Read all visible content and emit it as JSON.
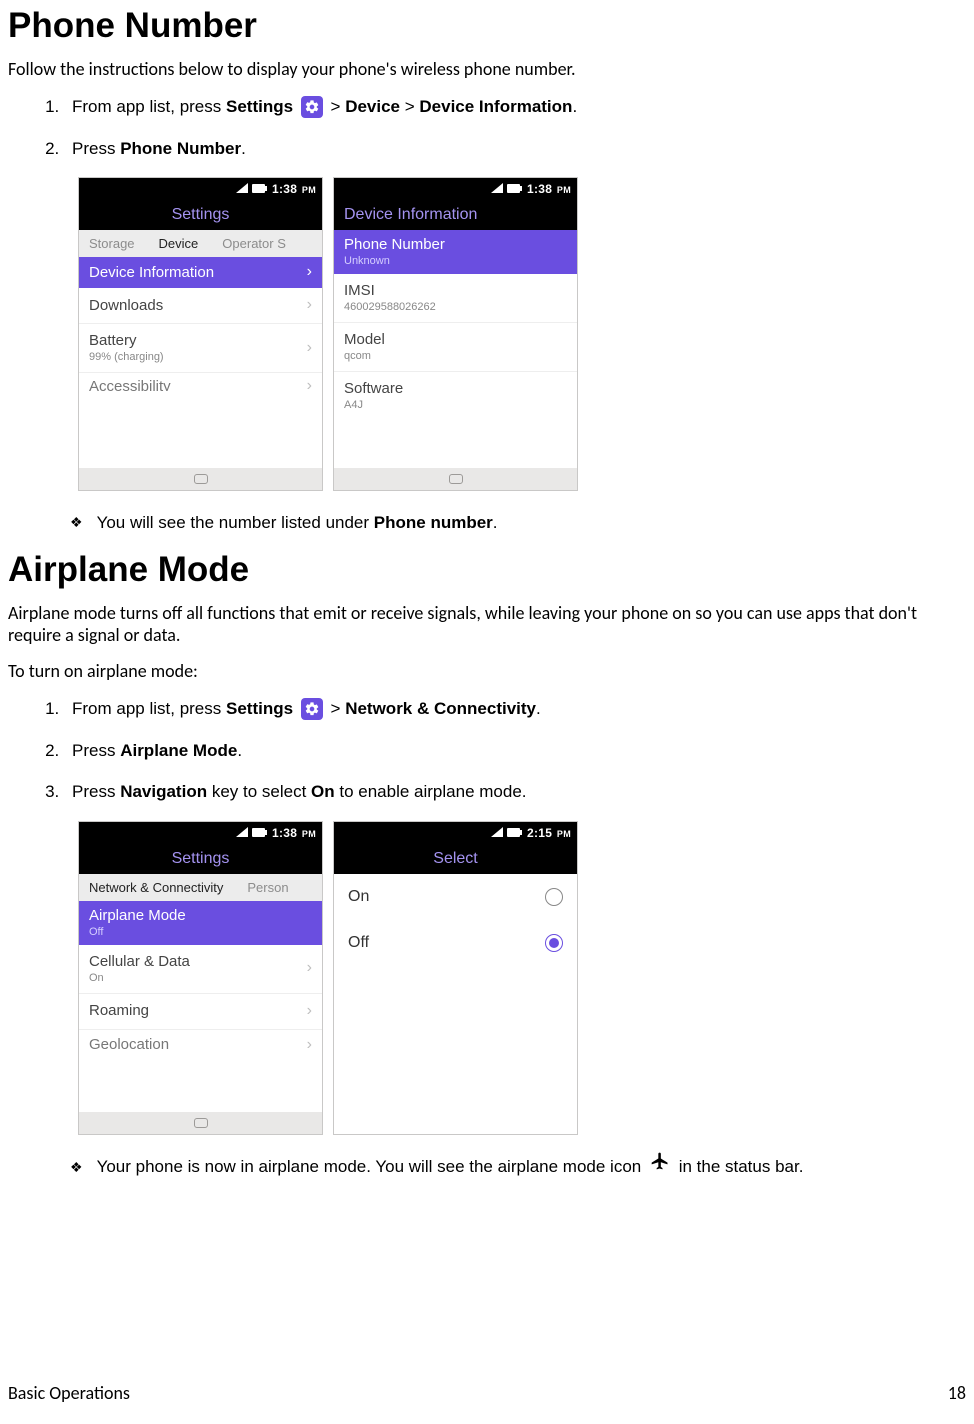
{
  "section1": {
    "title": "Phone Number",
    "lead": "Follow the instructions below to display your phone's wireless phone number.",
    "step1_a": "From app list, press ",
    "step1_b": "Settings",
    "step1_c": " > ",
    "step1_d": "Device",
    "step1_e": " > ",
    "step1_f": "Device Information",
    "step1_g": ".",
    "step2_a": "Press ",
    "step2_b": "Phone Number",
    "step2_c": ".",
    "note_a": "You will see the number listed under ",
    "note_b": "Phone number",
    "note_c": "."
  },
  "shot1a": {
    "time": "1:38",
    "ampm": "PM",
    "header": "Settings",
    "tab1": "Storage",
    "tab2": "Device",
    "tab3": "Operator S",
    "sel": "Device Information",
    "r1": "Downloads",
    "r2": "Battery",
    "r2_sub": "99% (charging)",
    "r3": "Accessibility"
  },
  "shot1b": {
    "time": "1:38",
    "ampm": "PM",
    "header": "Device Information",
    "sel": "Phone Number",
    "sel_sub": "Unknown",
    "r1": "IMSI",
    "r1_sub": "460029588026262",
    "r2": "Model",
    "r2_sub": "qcom",
    "r3": "Software",
    "r3_sub": "A4J"
  },
  "section2": {
    "title": "Airplane Mode",
    "lead": "Airplane mode turns off all functions that emit or receive signals, while leaving your phone on so you can use apps that don't require a signal or data.",
    "sublead": "To turn on airplane mode:",
    "step1_a": "From app list, press ",
    "step1_b": "Settings",
    "step1_c": " > ",
    "step1_d": "Network & Connectivity",
    "step1_e": ".",
    "step2_a": "Press ",
    "step2_b": "Airplane Mode",
    "step2_c": ".",
    "step3_a": "Press ",
    "step3_b": "Navigation",
    "step3_c": " key to select ",
    "step3_d": "On",
    "step3_e": " to enable airplane mode.",
    "note_a": "Your phone is now in airplane mode. You will see the airplane mode icon ",
    "note_b": " in the status bar."
  },
  "shot2a": {
    "time": "1:38",
    "ampm": "PM",
    "header": "Settings",
    "tab1": "Network & Connectivity",
    "tab2": "Person",
    "sel": "Airplane Mode",
    "sel_sub": "Off",
    "r1": "Cellular & Data",
    "r1_sub": "On",
    "r2": "Roaming",
    "r3": "Geolocation"
  },
  "shot2b": {
    "time": "2:15",
    "ampm": "PM",
    "header": "Select",
    "opt1": "On",
    "opt2": "Off"
  },
  "footer": {
    "left": "Basic Operations",
    "right": "18"
  }
}
